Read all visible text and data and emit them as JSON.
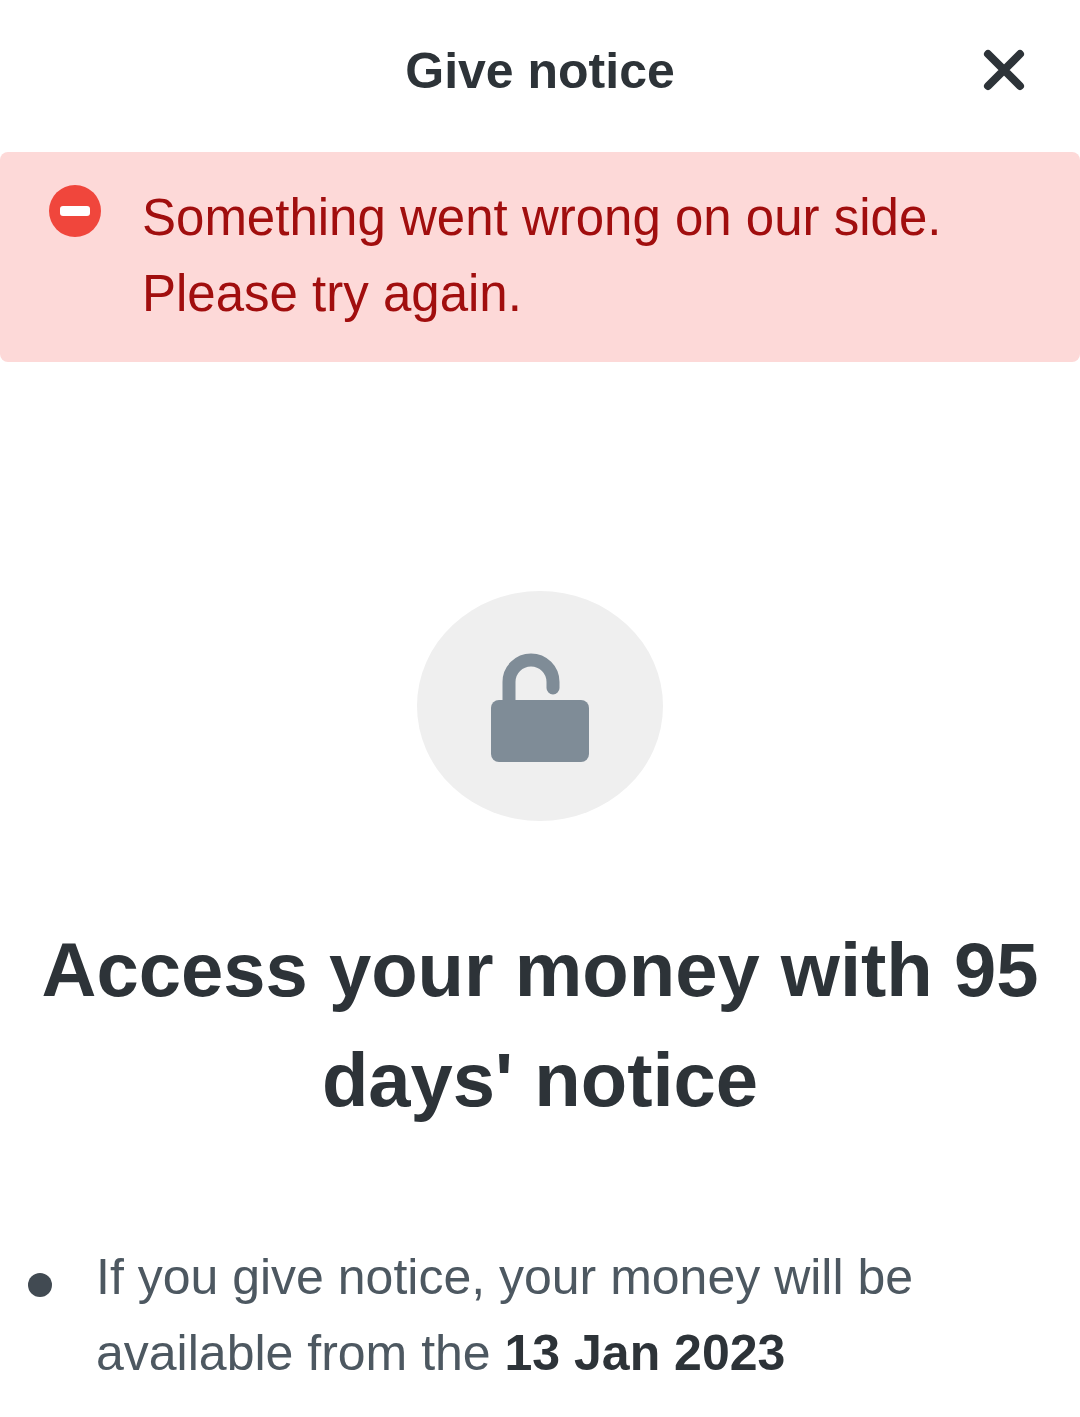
{
  "header": {
    "title": "Give notice"
  },
  "error": {
    "message": "Something went wrong on our side. Please try again."
  },
  "heading": "Access your money with 95 days' notice",
  "bullets": [
    "If you give notice, your money will be available from the **13 Jan 2023**"
  ]
}
